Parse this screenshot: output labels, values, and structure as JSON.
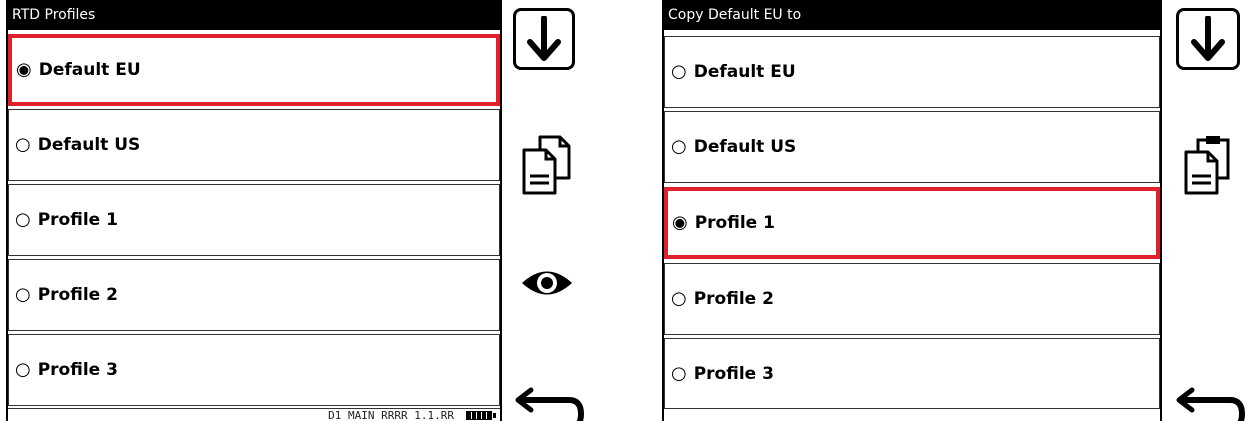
{
  "left_screen": {
    "title": "RTD Profiles",
    "rows": [
      {
        "radio": "◉",
        "label": "Default EU",
        "selected": true
      },
      {
        "radio": "○",
        "label": "Default US",
        "selected": false
      },
      {
        "radio": "○",
        "label": "Profile 1",
        "selected": false
      },
      {
        "radio": "○",
        "label": "Profile 2",
        "selected": false
      },
      {
        "radio": "○",
        "label": "Profile 3",
        "selected": false
      }
    ],
    "status_text": "D1 MAIN RRRR 1.1.RR",
    "side_icons": [
      "arrow-down-icon",
      "copy-icon",
      "eye-icon",
      "back-arrow-icon"
    ]
  },
  "right_screen": {
    "title": "Copy Default EU to",
    "rows": [
      {
        "radio": "○",
        "label": "Default EU",
        "selected": false
      },
      {
        "radio": "○",
        "label": "Default US",
        "selected": false
      },
      {
        "radio": "◉",
        "label": "Profile 1",
        "selected": true
      },
      {
        "radio": "○",
        "label": "Profile 2",
        "selected": false
      },
      {
        "radio": "○",
        "label": "Profile 3",
        "selected": false
      }
    ],
    "side_icons": [
      "arrow-down-icon",
      "paste-icon",
      "back-arrow-icon"
    ]
  },
  "colors": {
    "selection_border": "#e0202a",
    "title_bg": "#000000",
    "title_text": "#ffffff"
  }
}
